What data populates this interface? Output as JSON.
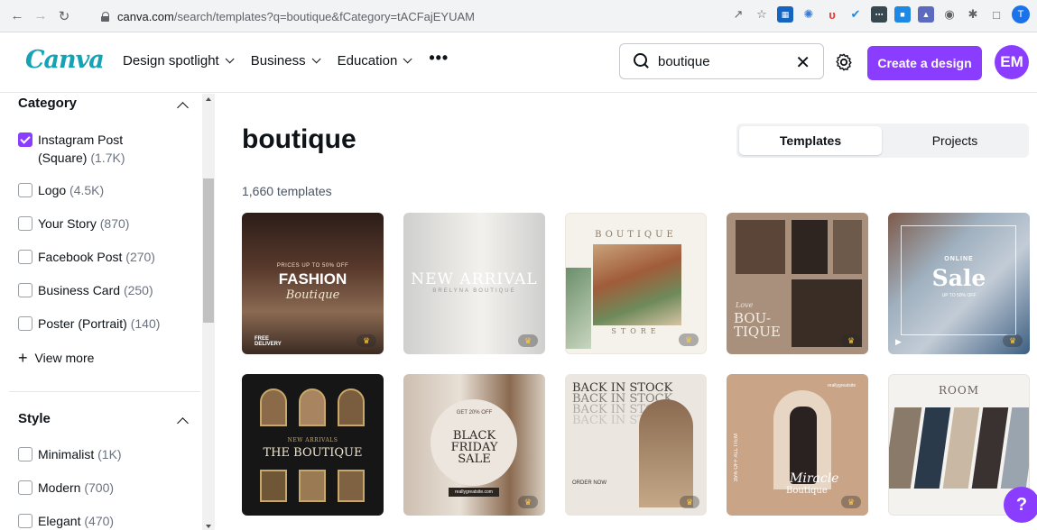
{
  "browser": {
    "url_host": "canva.com",
    "url_rest": "/search/templates?q=boutique&fCategory=tACFajEYUAM",
    "profile_initial": "T"
  },
  "header": {
    "logo": "Canva",
    "nav": [
      {
        "label": "Design spotlight"
      },
      {
        "label": "Business"
      },
      {
        "label": "Education"
      }
    ],
    "more": "•••",
    "search_value": "boutique",
    "create_label": "Create a design",
    "avatar": "EM"
  },
  "sidebar": {
    "category_title": "Category",
    "category_options": [
      {
        "label": "Instagram Post",
        "label2": "(Square)",
        "count": "(1.7K)",
        "checked": true
      },
      {
        "label": "Logo",
        "count": "(4.5K)"
      },
      {
        "label": "Your Story",
        "count": "(870)"
      },
      {
        "label": "Facebook Post",
        "count": "(270)"
      },
      {
        "label": "Business Card",
        "count": "(250)"
      },
      {
        "label": "Poster (Portrait)",
        "count": "(140)"
      }
    ],
    "view_more": "View more",
    "style_title": "Style",
    "style_options": [
      {
        "label": "Minimalist",
        "count": "(1K)"
      },
      {
        "label": "Modern",
        "count": "(700)"
      },
      {
        "label": "Elegant",
        "count": "(470)"
      }
    ]
  },
  "main": {
    "title": "boutique",
    "tabs": [
      "Templates",
      "Projects"
    ],
    "count": "1,660 templates",
    "cards": [
      {
        "lines": [
          "PRICES UP TO 50% OFF",
          "FASHION",
          "Boutique",
          "FREE DELIVERY"
        ],
        "bg": "#3b2a22"
      },
      {
        "lines": [
          "NEW ARRIVAL",
          "BRELYNA BOUTIQUE"
        ],
        "bg": "#d9d9d7"
      },
      {
        "lines": [
          "BOUTIQUE",
          "STORE"
        ],
        "bg": "#f3f0ea"
      },
      {
        "lines": [
          "Love",
          "BOU-",
          "TIQUE"
        ],
        "bg": "#b39a86"
      },
      {
        "lines": [
          "ONLINE",
          "Sale",
          "UP TO 50% OFF"
        ],
        "bg": "#6a7d8c"
      },
      {
        "lines": [
          "NEW ARRIVALS",
          "THE BOUTIQUE"
        ],
        "bg": "#1a1a1a"
      },
      {
        "lines": [
          "GET 20% OFF",
          "BLACK",
          "FRIDAY",
          "SALE",
          "reallygreatsite.com"
        ],
        "bg": "#e9e2da"
      },
      {
        "lines": [
          "BACK IN STOCK",
          "ORDER NOW"
        ],
        "bg": "#e7e2dc"
      },
      {
        "lines": [
          "35% OFF ALL ITEM",
          "Miracle",
          "Boutique",
          "reallygreatsite"
        ],
        "bg": "#c9a486"
      },
      {
        "lines": [
          "ROOM"
        ],
        "bg": "#f4f2ef"
      }
    ]
  },
  "help": "?"
}
